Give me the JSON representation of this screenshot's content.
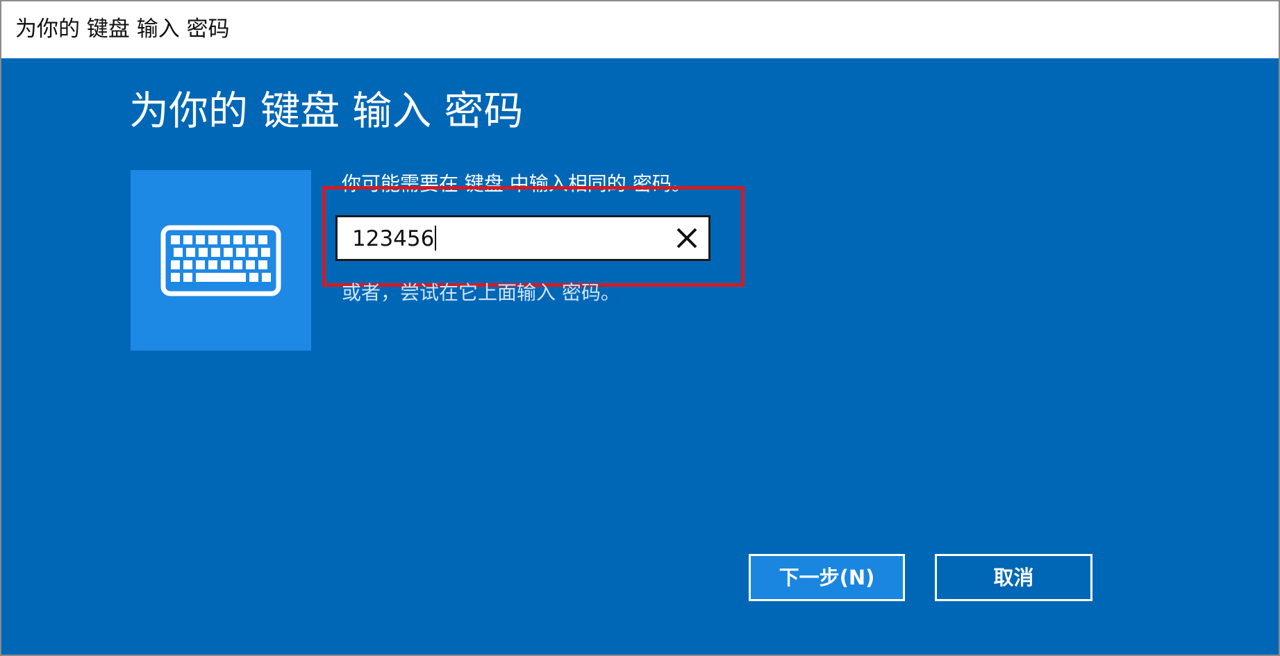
{
  "window": {
    "title": "为你的 键盘 输入 密码"
  },
  "main": {
    "heading": "为你的 键盘 输入 密码",
    "hint": "你可能需要在 键盘 中输入相同的 密码。",
    "alt_hint": "或者，尝试在它上面输入 密码。",
    "icon": "keyboard-icon"
  },
  "passcode_input": {
    "value": "123456",
    "clear_icon": "close-icon"
  },
  "buttons": {
    "next_label": "下一步(N)",
    "cancel_label": "取消"
  },
  "colors": {
    "background": "#0067b6",
    "tile": "#1e88e5",
    "highlight": "#d01c24",
    "primary_button": "#1a86e0"
  }
}
